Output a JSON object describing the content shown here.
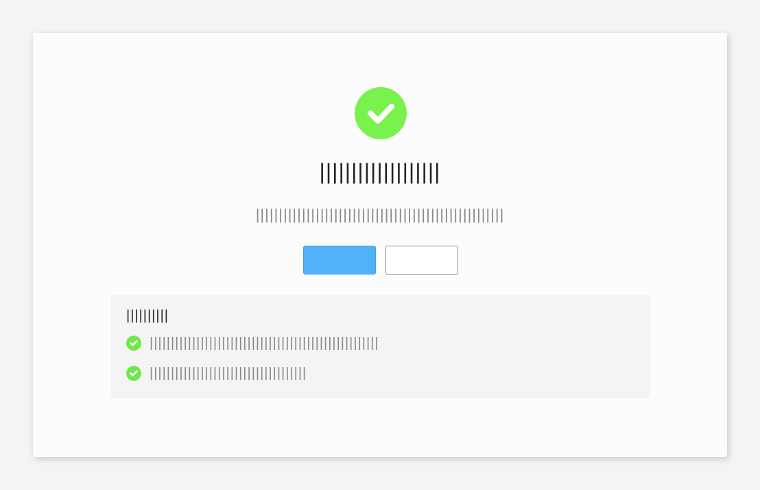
{
  "dialog": {
    "title": "|||||||||||||||||||",
    "message": "||||||||||||||||||||||||||||||||||||||||||||||||||||||",
    "primary_button_label": "",
    "secondary_button_label": "",
    "icon": "check-circle-icon",
    "accent_color": "#7af24e",
    "primary_color": "#52b2f7"
  },
  "details": {
    "title": "||||||||||",
    "items": [
      {
        "icon": "check-circle-icon",
        "text": "||||||||||||||||||||||||||||||||||||||||||||||||||||||"
      },
      {
        "icon": "check-circle-icon",
        "text": "|||||||||||||||||||||||||||||||||||||"
      }
    ]
  }
}
